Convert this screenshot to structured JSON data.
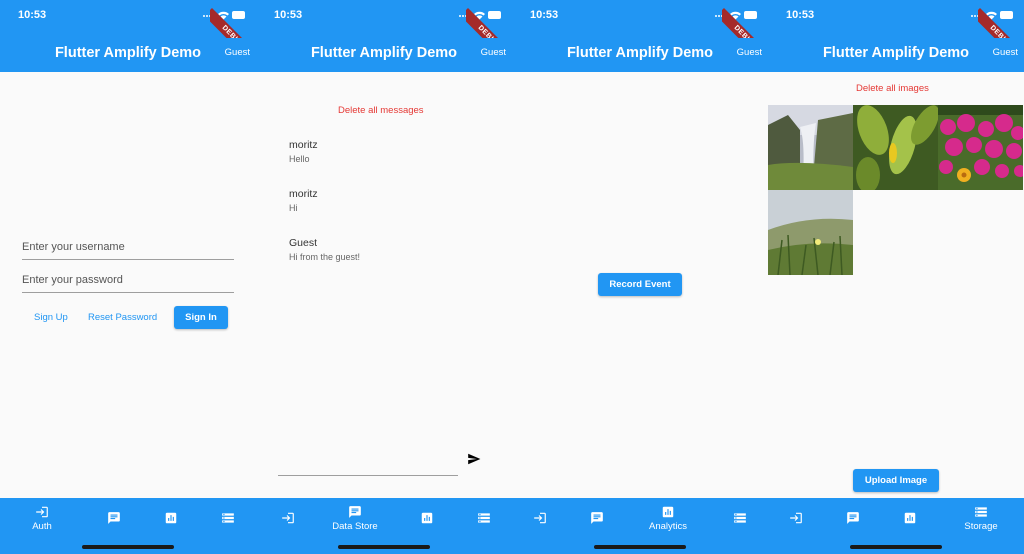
{
  "status": {
    "time": "10:53"
  },
  "debug_banner": "DEBUG",
  "app": {
    "title": "Flutter Amplify Demo",
    "user": "Guest"
  },
  "colors": {
    "primary": "#2196f3",
    "danger": "#e53935",
    "background": "#fafafa"
  },
  "nav": {
    "auth": {
      "label": "Auth",
      "icon": "login-icon"
    },
    "datastore": {
      "label": "Data Store",
      "icon": "chat-icon"
    },
    "analytics": {
      "label": "Analytics",
      "icon": "analytics-icon"
    },
    "storage": {
      "label": "Storage",
      "icon": "storage-icon"
    }
  },
  "auth": {
    "username_placeholder": "Enter your username",
    "password_placeholder": "Enter your password",
    "sign_up": "Sign Up",
    "reset_password": "Reset Password",
    "sign_in": "Sign In"
  },
  "datastore": {
    "delete_all": "Delete all messages",
    "messages": [
      {
        "author": "moritz",
        "text": "Hello"
      },
      {
        "author": "moritz",
        "text": "Hi"
      },
      {
        "author": "Guest",
        "text": "Hi from the guest!"
      }
    ],
    "send_icon": "send-icon"
  },
  "analytics": {
    "record_event": "Record Event"
  },
  "storage": {
    "delete_all": "Delete all images",
    "images": [
      "waterfall",
      "green-leaves",
      "pink-flowers",
      "grass-hillside"
    ],
    "upload": "Upload Image"
  }
}
